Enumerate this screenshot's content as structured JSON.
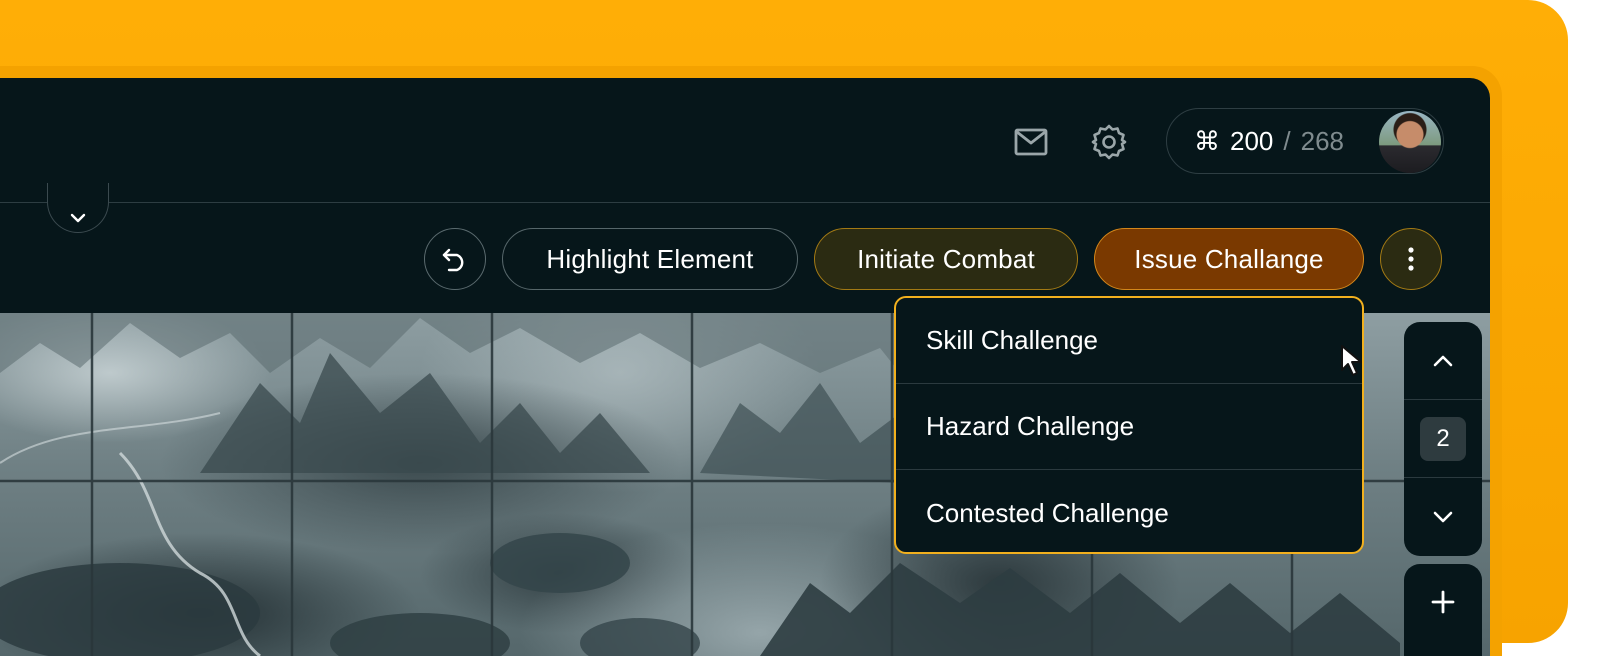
{
  "header": {
    "mail_icon": "mail-icon",
    "settings_icon": "gear-icon",
    "credits": {
      "symbol": "⌘",
      "used": "200",
      "separator": "/",
      "total": "268"
    }
  },
  "toolbar": {
    "undo_icon": "undo-icon",
    "highlight_label": "Highlight Element",
    "combat_label": "Initiate Combat",
    "challenge_label": "Issue Challange",
    "more_icon": "more-vertical-icon"
  },
  "challenge_menu": {
    "items": [
      {
        "label": "Skill Challenge"
      },
      {
        "label": "Hazard Challenge"
      },
      {
        "label": "Contested Challenge"
      }
    ]
  },
  "level_control": {
    "current_level": "2"
  },
  "colors": {
    "accent": "#f5a700",
    "panel": "#06161a",
    "challenge_active": "#7a3900",
    "combat": "#2b2b12"
  }
}
